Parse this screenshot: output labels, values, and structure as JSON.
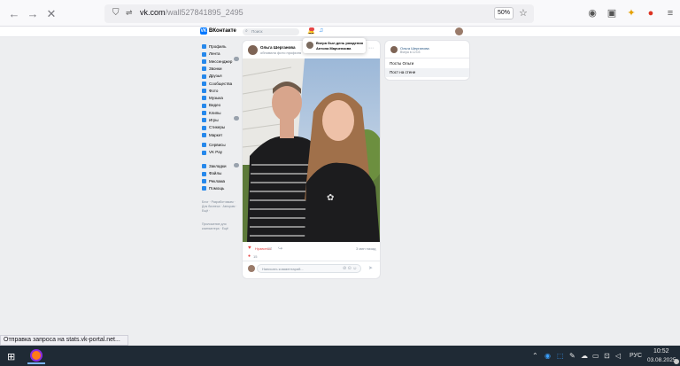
{
  "browser": {
    "url_host": "vk.com",
    "url_path": "/wall527841895_2495",
    "zoom": "50%",
    "status_text": "Отправка запроса на stats.vk-portal.net..."
  },
  "vk": {
    "logo": "ВКонтакте",
    "search_placeholder": "Поиск",
    "menu": [
      {
        "label": "Профиль"
      },
      {
        "label": "Лента"
      },
      {
        "label": "Мессенджер"
      },
      {
        "label": "Звонки"
      },
      {
        "label": "Друзья"
      },
      {
        "label": "Сообщества"
      },
      {
        "label": "Фото"
      },
      {
        "label": "Музыка"
      },
      {
        "label": "Видео"
      },
      {
        "label": "Клипы"
      },
      {
        "label": "Игры"
      },
      {
        "label": "Стикеры"
      },
      {
        "label": "Маркет"
      }
    ],
    "menu2": [
      {
        "label": "Сервисы"
      },
      {
        "label": "VK Pay"
      }
    ],
    "menu3": [
      {
        "label": "Закладки"
      },
      {
        "label": "Файлы"
      },
      {
        "label": "Реклама"
      },
      {
        "label": "Помощь"
      }
    ],
    "footer": "Блог · Разработчикам · Для бизнеса · Авторам · Ещё ·",
    "footer2": "Приложение для компьютера · Ещё",
    "tooltip": {
      "title": "Вчера был день рождения",
      "name": "Антона Марченкова"
    },
    "post": {
      "author": "Ольга Шерганова",
      "subtitle": "обновила фото профиля",
      "likes_label": "Нравится",
      "likes_count": "15",
      "time": "3 мин назад",
      "comment_placeholder": "Написать комментарий..."
    },
    "side": {
      "author": "Ольга Шерганова",
      "date": "Вчера в 12:03",
      "link1": "Посты Ольги",
      "link2": "Пост на стене"
    }
  },
  "taskbar": {
    "lang": "РУС",
    "time": "10:52",
    "date": "03.08.2025"
  }
}
